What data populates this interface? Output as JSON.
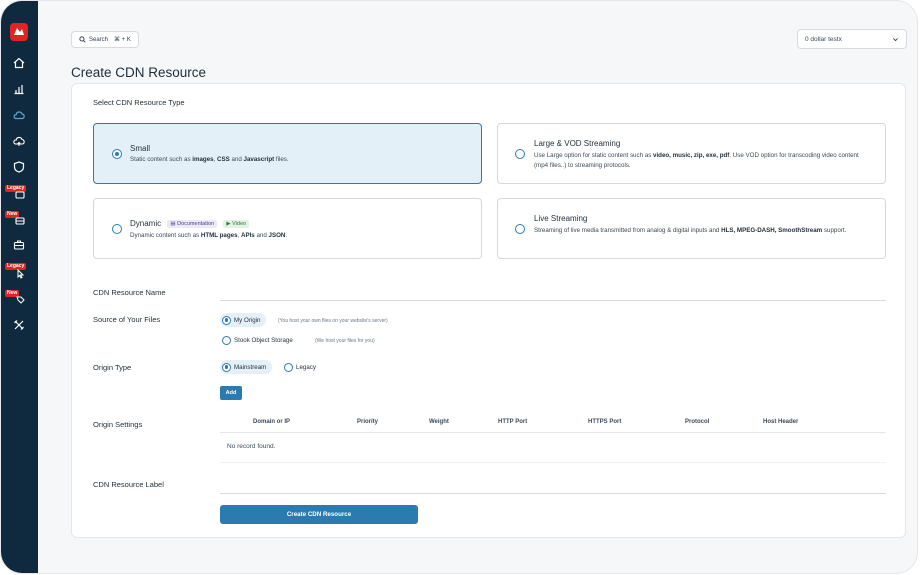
{
  "sidebar": {
    "badges": {
      "legacy1": "Legacy",
      "new1": "New",
      "legacy2": "Legacy",
      "new2": "New"
    }
  },
  "topbar": {
    "search_label": "Search",
    "search_shortcut": "⌘ + K",
    "account_name": "0 dollar testx"
  },
  "page": {
    "title": "Create CDN Resource"
  },
  "form": {
    "select_type_label": "Select CDN Resource Type",
    "types": {
      "small": {
        "title": "Small",
        "desc_pre": "Static content such as ",
        "desc_bold1": "images",
        "desc_mid1": ", ",
        "desc_bold2": "CSS",
        "desc_mid2": " and ",
        "desc_bold3": "Javascript",
        "desc_post": " files."
      },
      "large": {
        "title": "Large & VOD Streaming",
        "desc_pre": "Use Large option for static content such as ",
        "desc_bold": "video, music, zip, exe, pdf",
        "desc_post": ". Use VOD option for transcoding video content (mp4 files..) to streaming protocols."
      },
      "dynamic": {
        "title": "Dynamic",
        "chip_doc": "Documentation",
        "chip_video": "Video",
        "desc_pre": "Dynamic content such as ",
        "desc_bold1": "HTML pages",
        "desc_mid": ", ",
        "desc_bold2": "APIs",
        "desc_mid2": " and ",
        "desc_bold3": "JSON",
        "desc_post": "."
      },
      "live": {
        "title": "Live Streaming",
        "desc_pre": "Streaming of live media transmitted from analog & digital inputs and ",
        "desc_bold": "HLS, MPEG-DASH, SmoothStream",
        "desc_post": " support."
      }
    },
    "resource_name_label": "CDN Resource Name",
    "source_label": "Source of Your Files",
    "source_options": {
      "my_origin": "My Origin",
      "my_origin_hint": "(You host your own files on your website's server)",
      "stook": "Stook Object Storage",
      "stook_hint": "(We host your files for you)"
    },
    "origin_type_label": "Origin Type",
    "origin_types": {
      "mainstream": "Mainstream",
      "legacy": "Legacy"
    },
    "add_label": "Add",
    "origin_settings_label": "Origin Settings",
    "table": {
      "columns": [
        "Domain or IP",
        "Priority",
        "Weight",
        "HTTP Port",
        "HTTPS Port",
        "Protocol",
        "Host Header"
      ],
      "empty_text": "No record found."
    },
    "resource_label_label": "CDN Resource Label",
    "create_label": "Create CDN Resource"
  },
  "colors": {
    "sidebar": "#0f2a3f",
    "accent": "#2b7bb1",
    "brand": "#e02424"
  }
}
